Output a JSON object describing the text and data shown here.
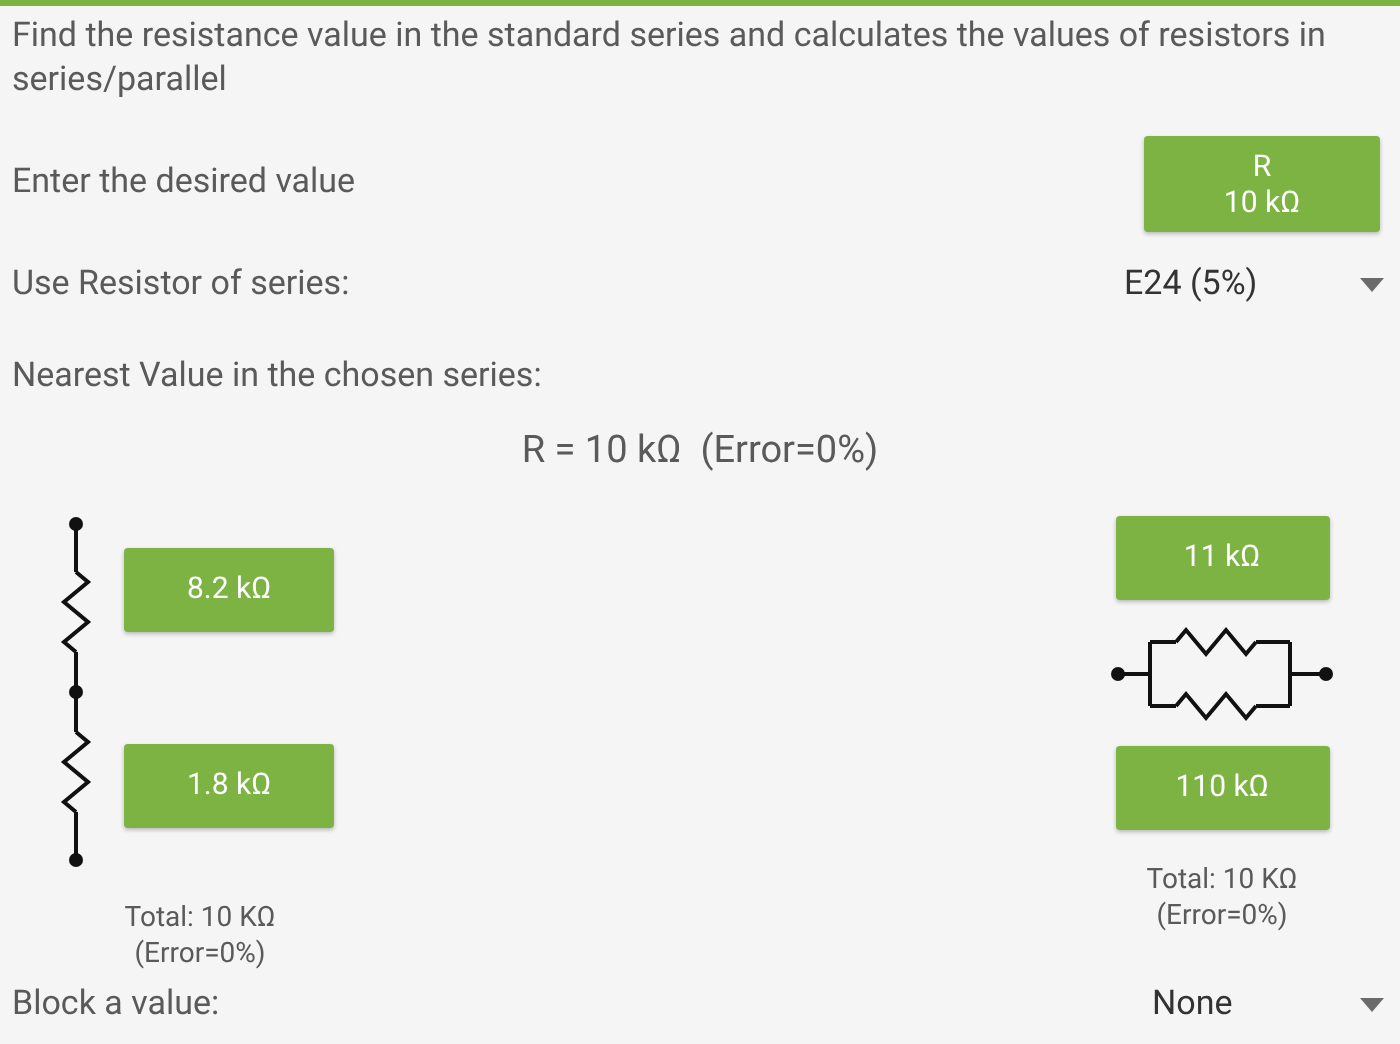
{
  "intro": "Find the resistance value in the standard series and calculates the values of resistors in series/parallel",
  "desired": {
    "label": "Enter the desired value",
    "button_lines": [
      "R",
      "10 kΩ"
    ]
  },
  "series": {
    "label": "Use Resistor of series:",
    "value": "E24 (5%)"
  },
  "nearest": {
    "label": "Nearest Value in the chosen series:",
    "result": "R = 10 kΩ  (Error=0%)"
  },
  "series_circuit": {
    "resistors": [
      "8.2 kΩ",
      "1.8 kΩ"
    ],
    "total": "Total: 10 KΩ",
    "error": "(Error=0%)"
  },
  "parallel_circuit": {
    "resistors": [
      "11 kΩ",
      "110 kΩ"
    ],
    "total": "Total: 10 KΩ",
    "error": "(Error=0%)"
  },
  "block": {
    "label": "Block a value:",
    "value": "None"
  }
}
